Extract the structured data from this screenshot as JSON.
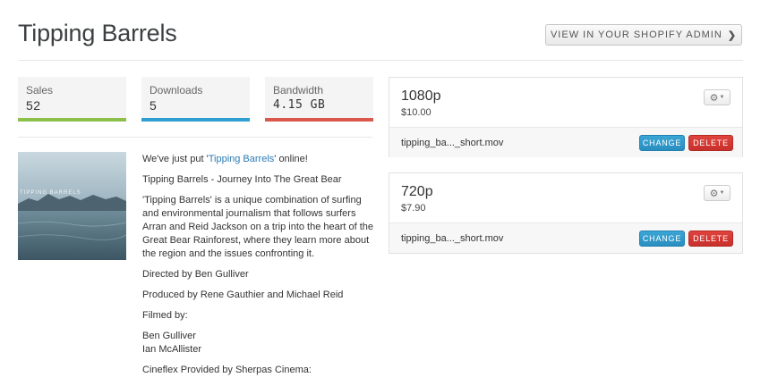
{
  "header": {
    "title": "Tipping Barrels",
    "admin_button_label": "VIEW IN YOUR SHOPIFY ADMIN",
    "admin_button_icon": "chevron-right-icon"
  },
  "stats": [
    {
      "label": "Sales",
      "value": "52",
      "color": "#8cc04a"
    },
    {
      "label": "Downloads",
      "value": "5",
      "color": "#2e9fd0"
    },
    {
      "label": "Bandwidth",
      "value": "4.15 GB",
      "color": "#d9574d"
    }
  ],
  "product": {
    "thumbnail_caption": "TIPPING BARRELS",
    "intro_before": "We've just put '",
    "intro_link": "Tipping Barrels",
    "intro_after": "' online!",
    "subtitle": "Tipping Barrels - Journey Into The Great Bear",
    "description": "'Tipping Barrels' is a unique combination of surfing and environmental journalism that follows surfers Arran and Reid Jackson on a trip into the heart of the Great Bear Rainforest, where they learn more about the region and the issues confronting it.",
    "directed_by": "Directed by Ben Gulliver",
    "produced_by": "Produced by Rene Gauthier and Michael Reid",
    "filmed_by_label": "Filmed by:",
    "filmed_by_1": "Ben Gulliver",
    "filmed_by_2": "Ian McAllister",
    "cineflex": "Cineflex Provided by Sherpas Cinema:"
  },
  "variants": [
    {
      "resolution": "1080p",
      "price": "$10.00",
      "filename": "tipping_ba..._short.mov",
      "change_label": "CHANGE",
      "delete_label": "DELETE",
      "gear_icon": "gear-icon"
    },
    {
      "resolution": "720p",
      "price": "$7.90",
      "filename": "tipping_ba..._short.mov",
      "change_label": "CHANGE",
      "delete_label": "DELETE",
      "gear_icon": "gear-icon"
    }
  ],
  "colors": {
    "link": "#2a7bb5",
    "change_button": "#2e9fd0",
    "delete_button": "#d23a35"
  }
}
